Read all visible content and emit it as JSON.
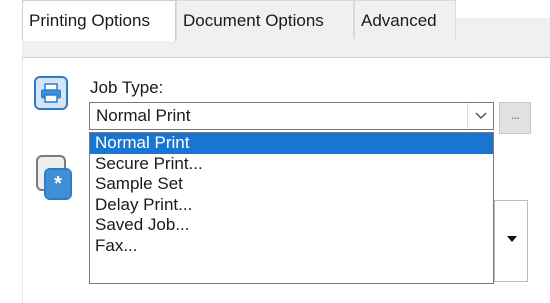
{
  "tabs": [
    {
      "label": "Printing Options",
      "active": true
    },
    {
      "label": "Document Options",
      "active": false
    },
    {
      "label": "Advanced",
      "active": false
    }
  ],
  "job_type": {
    "label": "Job Type:",
    "selected": "Normal Print",
    "more_button": "...",
    "options": [
      "Normal Print",
      "Secure Print...",
      "Sample Set",
      "Delay Print...",
      "Saved Job...",
      "Fax..."
    ],
    "highlighted_index": 0
  },
  "icons": {
    "job_type": "printer-icon",
    "collation": "collate-icon"
  },
  "colors": {
    "accent": "#1a74d2",
    "icon_blue": "#2d7cc8"
  }
}
